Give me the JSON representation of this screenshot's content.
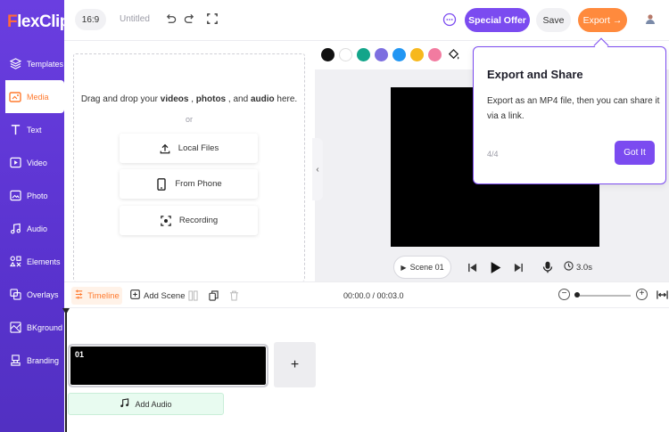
{
  "brand": {
    "name_first": "F",
    "name_rest": "lexClip"
  },
  "sidebar": {
    "items": [
      {
        "label": "Templates",
        "icon": "layers-icon",
        "active": false
      },
      {
        "label": "Media",
        "icon": "media-icon",
        "active": true
      },
      {
        "label": "Text",
        "icon": "text-icon",
        "active": false
      },
      {
        "label": "Video",
        "icon": "video-icon",
        "active": false
      },
      {
        "label": "Photo",
        "icon": "photo-icon",
        "active": false
      },
      {
        "label": "Audio",
        "icon": "music-icon",
        "active": false
      },
      {
        "label": "Elements",
        "icon": "elements-icon",
        "active": false
      },
      {
        "label": "Overlays",
        "icon": "overlays-icon",
        "active": false
      },
      {
        "label": "BKground",
        "icon": "background-icon",
        "active": false
      },
      {
        "label": "Branding",
        "icon": "branding-icon",
        "active": false
      }
    ]
  },
  "topbar": {
    "ratio": "16:9",
    "title": "Untitled",
    "special_offer": "Special Offer",
    "save": "Save",
    "export": "Export"
  },
  "media": {
    "drag_prefix": "Drag and drop your ",
    "drag_videos": "videos",
    "drag_sep1": " , ",
    "drag_photos": "photos",
    "drag_sep2": " , and ",
    "drag_audio": "audio",
    "drag_suffix": " here.",
    "or": "or",
    "local_files": "Local Files",
    "from_phone": "From Phone",
    "recording": "Recording"
  },
  "palette": [
    "#111111",
    "#ffffff",
    "#13a58a",
    "#7d6fe0",
    "#2196f3",
    "#f7b81d",
    "#f27ba0"
  ],
  "player": {
    "scene": "Scene 01",
    "duration": "3.0s"
  },
  "tooltip": {
    "title": "Export and Share",
    "body": "Export as an MP4 file, then you can share it via a link.",
    "step": "4/4",
    "button": "Got It"
  },
  "timeline": {
    "tab": "Timeline",
    "add_scene": "Add Scene",
    "timecode": "00:00.0 / 00:03.0",
    "zoom_level": 0.1,
    "clip_label": "01",
    "add_audio": "Add Audio"
  },
  "colors": {
    "accent": "#7b4bf0",
    "export": "#ff8a3d",
    "sidebar": "#6a3ee0"
  }
}
